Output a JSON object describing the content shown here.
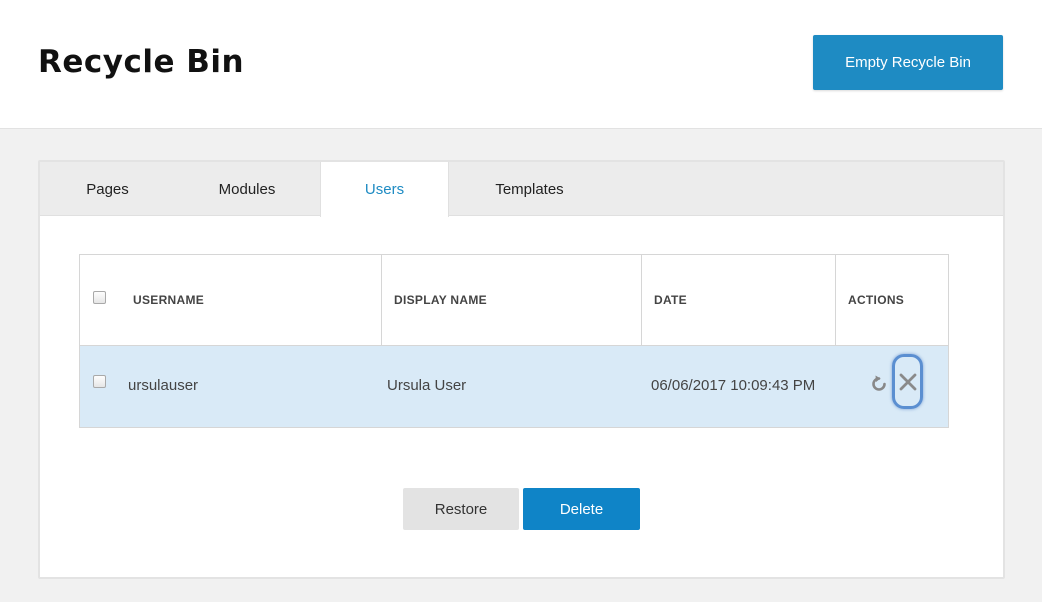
{
  "header": {
    "title": "Recycle Bin",
    "empty_button_label": "Empty Recycle Bin"
  },
  "tabs": [
    {
      "label": "Pages",
      "active": false
    },
    {
      "label": "Modules",
      "active": false
    },
    {
      "label": "Users",
      "active": true
    },
    {
      "label": "Templates",
      "active": false
    }
  ],
  "grid": {
    "columns": [
      "USERNAME",
      "DISPLAY NAME",
      "DATE",
      "ACTIONS"
    ],
    "rows": [
      {
        "username": "ursulauser",
        "display_name": "Ursula User",
        "date": "06/06/2017 10:09:43 PM",
        "selected": false,
        "actions": [
          "restore-icon",
          "close-icon"
        ]
      }
    ]
  },
  "footer_buttons": {
    "restore_label": "Restore",
    "delete_label": "Delete"
  },
  "colors": {
    "accent": "#1e8bc3",
    "row_highlight": "#d9eaf7",
    "focus_ring": "#5b8fd1"
  }
}
